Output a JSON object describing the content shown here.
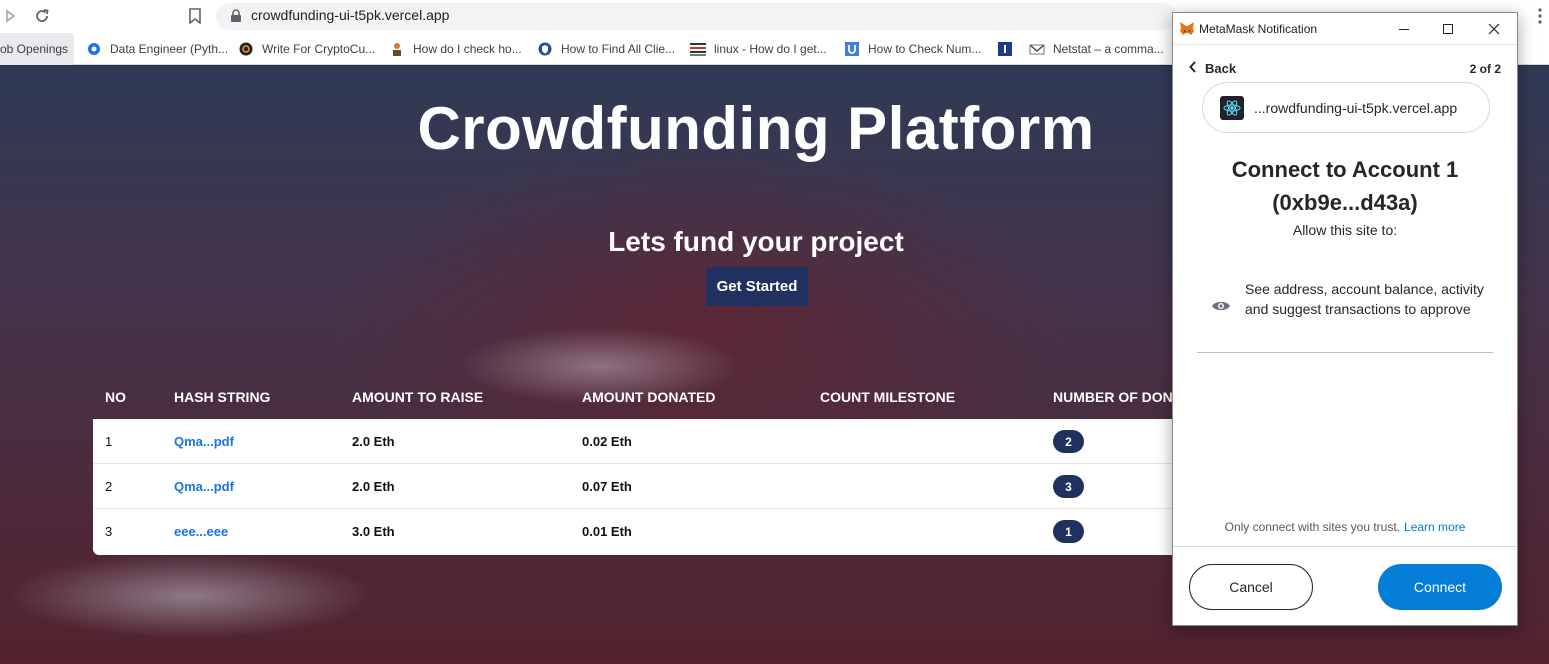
{
  "browser": {
    "url": "crowdfunding-ui-t5pk.vercel.app",
    "bookmarks": [
      {
        "label": "ob Openings",
        "icon": "bookmark-icon"
      },
      {
        "label": "Data Engineer (Pyth...",
        "icon": "globe-icon"
      },
      {
        "label": "Write For CryptoCu...",
        "icon": "crypto-icon"
      },
      {
        "label": "How do I check ho...",
        "icon": "person-icon"
      },
      {
        "label": "How to Find All Clie...",
        "icon": "shield-icon"
      },
      {
        "label": "linux - How do I get...",
        "icon": "stack-icon"
      },
      {
        "label": "How to Check Num...",
        "icon": "u-icon"
      },
      {
        "label": "",
        "icon": "i-icon"
      },
      {
        "label": "Netstat – a comma...",
        "icon": "netstat-icon"
      }
    ]
  },
  "page": {
    "title": "Crowdfunding Platform",
    "subtitle": "Lets fund your project",
    "cta": "Get Started",
    "table": {
      "headers": [
        "NO",
        "HASH STRING",
        "AMOUNT TO RAISE",
        "AMOUNT DONATED",
        "COUNT MILESTONE",
        "NUMBER OF DONO"
      ],
      "rows": [
        {
          "no": "1",
          "hash": "Qma...pdf",
          "raise": "2.0 Eth",
          "donated": "0.02 Eth",
          "milestone": "",
          "donors": "2"
        },
        {
          "no": "2",
          "hash": "Qma...pdf",
          "raise": "2.0 Eth",
          "donated": "0.07 Eth",
          "milestone": "",
          "donors": "3"
        },
        {
          "no": "3",
          "hash": "eee...eee",
          "raise": "3.0 Eth",
          "donated": "0.01 Eth",
          "milestone": "",
          "donors": "1"
        }
      ]
    }
  },
  "metamask": {
    "window_title": "MetaMask Notification",
    "back": "Back",
    "step": "2 of 2",
    "site": "...rowdfunding-ui-t5pk.vercel.app",
    "heading_line1": "Connect to Account 1",
    "heading_line2": "(0xb9e...d43a)",
    "allow": "Allow this site to:",
    "permission": "See address, account balance, activity and suggest transactions to approve",
    "trust": "Only connect with sites you trust.",
    "learn_more": "Learn more",
    "cancel": "Cancel",
    "connect": "Connect",
    "colors": {
      "primary": "#037dd6",
      "text": "#24272a"
    }
  },
  "colors": {
    "navy": "#20305f",
    "link": "#1a73e8"
  }
}
